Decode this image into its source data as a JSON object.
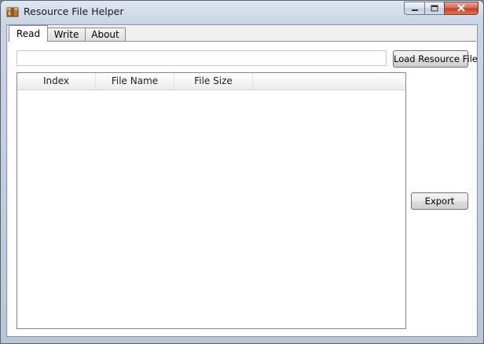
{
  "window": {
    "title": "Resource File Helper",
    "app_icon": "box-icon",
    "caption_buttons": [
      "minimize-icon",
      "maximize-icon",
      "close-icon"
    ],
    "accent_color": "#c13b24"
  },
  "tabs": [
    {
      "label": "Read",
      "active": true
    },
    {
      "label": "Write",
      "active": false
    },
    {
      "label": "About",
      "active": false
    }
  ],
  "read_tab": {
    "file_path": {
      "value": "",
      "placeholder": ""
    },
    "load_button_label": "Load Resource File",
    "export_button_label": "Export",
    "list": {
      "columns": [
        "Index",
        "File Name",
        "File Size"
      ],
      "rows": []
    }
  }
}
